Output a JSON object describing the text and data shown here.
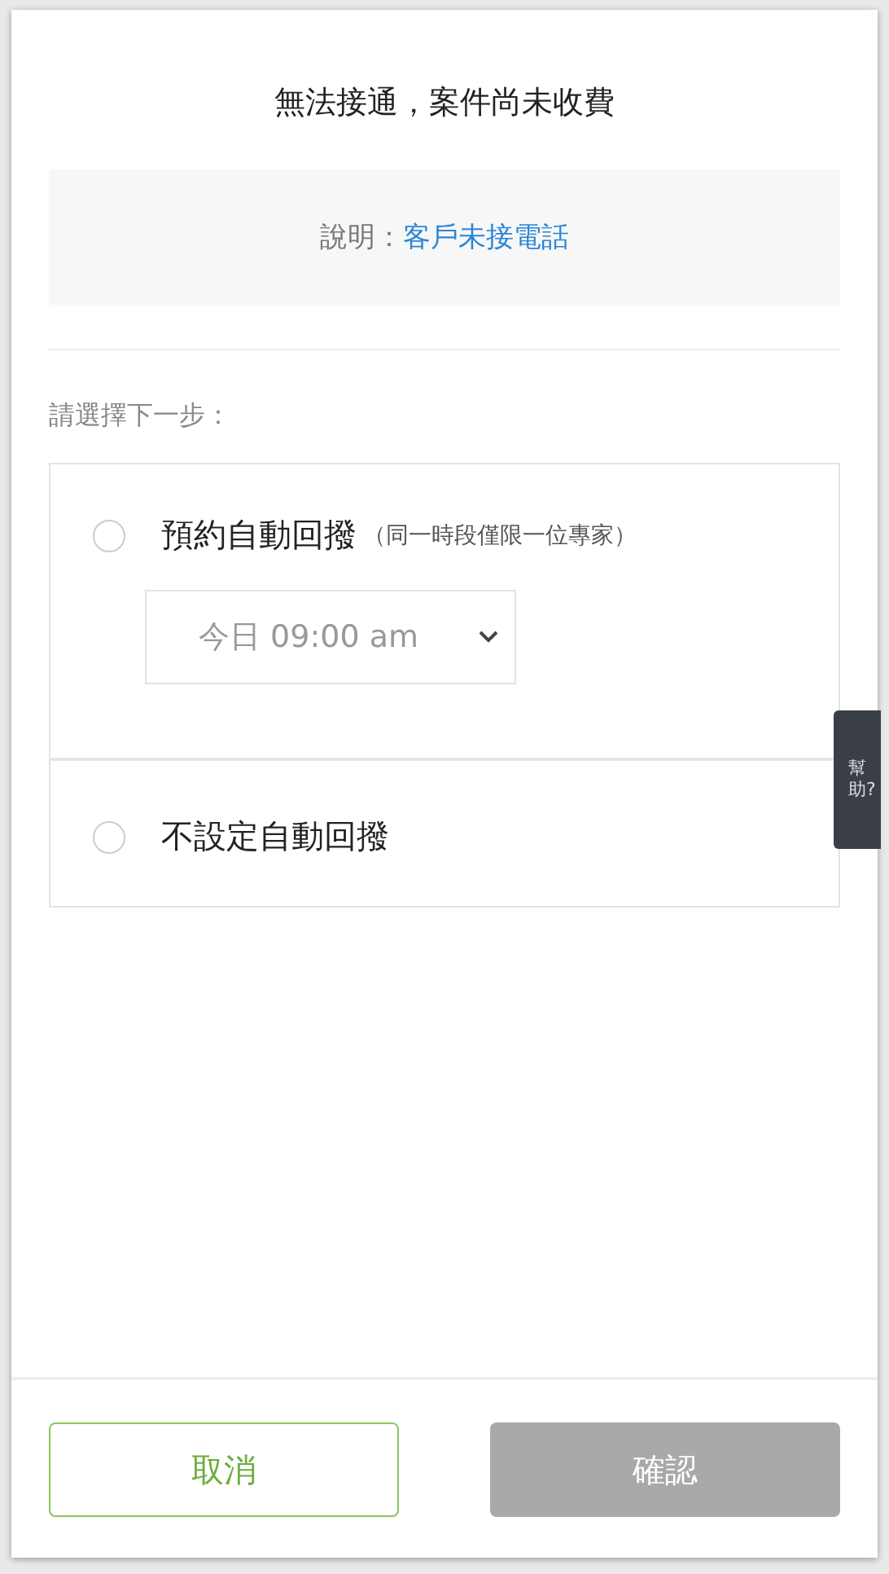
{
  "title": "無法接通，案件尚未收費",
  "note": {
    "label": "說明：",
    "value": "客戶未接電話"
  },
  "prompt": "請選擇下一步：",
  "options": [
    {
      "label": "預約自動回撥",
      "hint": "（同一時段僅限一位專家）",
      "selected": false,
      "select_value": "今日 09:00 am"
    },
    {
      "label": "不設定自動回撥",
      "selected": false
    }
  ],
  "help_tab": "幫助?",
  "buttons": [
    {
      "label": "取消",
      "kind": "outline",
      "disabled": false
    },
    {
      "label": "確認",
      "kind": "primary",
      "disabled": true
    }
  ]
}
